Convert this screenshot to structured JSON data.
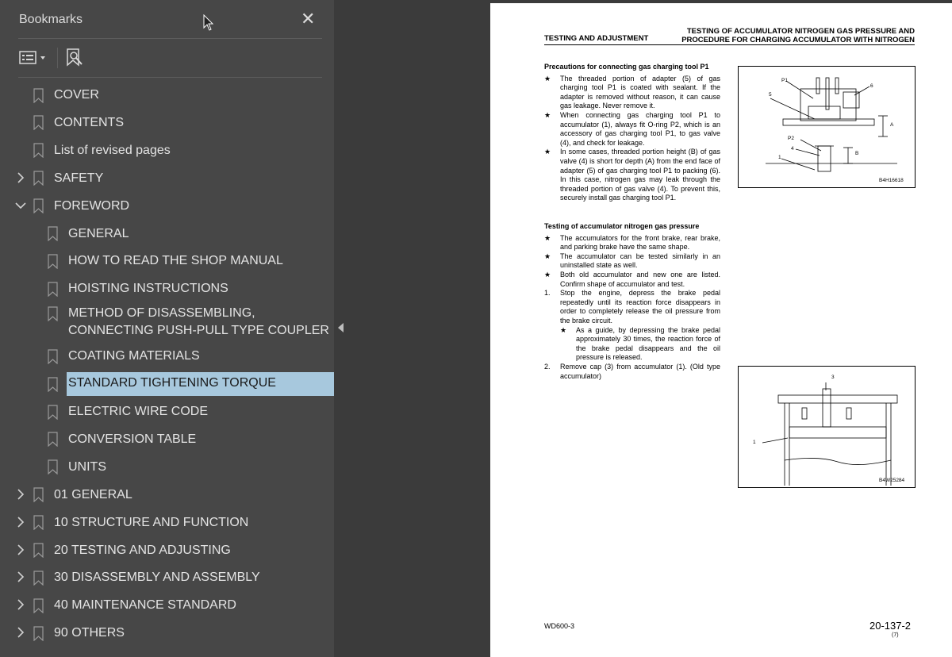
{
  "sidebar": {
    "title": "Bookmarks",
    "close_glyph": "✕",
    "toolbar": {
      "options_icon": "list-options-icon",
      "find_icon": "find-bookmark-icon"
    },
    "items": [
      {
        "label": "COVER",
        "level": 0,
        "expand": "none"
      },
      {
        "label": "CONTENTS",
        "level": 0,
        "expand": "none"
      },
      {
        "label": "List of revised pages",
        "level": 0,
        "expand": "none"
      },
      {
        "label": "SAFETY",
        "level": 0,
        "expand": "collapsed"
      },
      {
        "label": "FOREWORD",
        "level": 0,
        "expand": "expanded"
      },
      {
        "label": "GENERAL",
        "level": 1,
        "expand": "none"
      },
      {
        "label": "HOW TO READ THE SHOP MANUAL",
        "level": 1,
        "expand": "none"
      },
      {
        "label": "HOISTING INSTRUCTIONS",
        "level": 1,
        "expand": "none"
      },
      {
        "label": "METHOD OF DISASSEMBLING, CONNECTING PUSH-PULL TYPE COUPLER",
        "level": 1,
        "expand": "none"
      },
      {
        "label": "COATING MATERIALS",
        "level": 1,
        "expand": "none"
      },
      {
        "label": "STANDARD TIGHTENING TORQUE",
        "level": 1,
        "expand": "none",
        "selected": true
      },
      {
        "label": "ELECTRIC WIRE CODE",
        "level": 1,
        "expand": "none"
      },
      {
        "label": "CONVERSION TABLE",
        "level": 1,
        "expand": "none"
      },
      {
        "label": "UNITS",
        "level": 1,
        "expand": "none"
      },
      {
        "label": "01 GENERAL",
        "level": 0,
        "expand": "collapsed"
      },
      {
        "label": "10 STRUCTURE AND FUNCTION",
        "level": 0,
        "expand": "collapsed"
      },
      {
        "label": "20 TESTING AND ADJUSTING",
        "level": 0,
        "expand": "collapsed"
      },
      {
        "label": "30 DISASSEMBLY AND ASSEMBLY",
        "level": 0,
        "expand": "collapsed"
      },
      {
        "label": "40 MAINTENANCE STANDARD",
        "level": 0,
        "expand": "collapsed"
      },
      {
        "label": "90 OTHERS",
        "level": 0,
        "expand": "collapsed"
      }
    ]
  },
  "page": {
    "header_left": "TESTING AND ADJUSTMENT",
    "header_right_1": "TESTING OF ACCUMULATOR NITROGEN GAS PRESSURE AND",
    "header_right_2": "PROCEDURE FOR CHARGING ACCUMULATOR WITH NITROGEN",
    "section1": {
      "heading": "Precautions for connecting gas charging tool P1",
      "items": [
        {
          "mark": "★",
          "text": "The threaded portion of adapter (5) of gas charging tool P1 is coated with sealant. If the adapter is removed without reason, it can cause gas leakage. Never remove it."
        },
        {
          "mark": "★",
          "text": "When connecting gas charging tool P1 to accumulator (1), always fit O-ring P2, which is an accessory of gas charging tool P1, to gas valve (4), and check for leakage."
        },
        {
          "mark": "★",
          "text": "In some cases, threaded portion height (B) of gas valve (4) is short for depth (A) from the end face of adapter (5) of gas charging tool P1 to packing (6). In this case, nitrogen gas may leak through the threaded portion of gas valve (4). To prevent this, securely install gas charging tool P1."
        }
      ]
    },
    "section2": {
      "heading": "Testing of accumulator nitrogen gas pressure",
      "items": [
        {
          "mark": "★",
          "text": "The accumulators for the front brake, rear brake, and parking brake have the same shape."
        },
        {
          "mark": "★",
          "text": "The accumulator can be tested similarly in an uninstalled state as well."
        },
        {
          "mark": "★",
          "text": "Both old accumulator and new one are listed. Confirm shape of accumulator and test."
        },
        {
          "mark": "1.",
          "text": "Stop the engine, depress the brake pedal repeatedly until its reaction force disappears in order to completely release the oil pressure from the brake circuit."
        },
        {
          "mark": "★",
          "text": "As a guide, by depressing the brake pedal approximately 30 times, the reaction force of the brake pedal disappears and the oil pressure is released.",
          "sub": true
        },
        {
          "mark": "2.",
          "text": "Remove cap (3) from accumulator (1). (Old type accumulator)"
        }
      ]
    },
    "figure1": {
      "code": "B4H16618",
      "labels": [
        "P1",
        "6",
        "5",
        "P2",
        "4",
        "1",
        "A",
        "B"
      ]
    },
    "figure2": {
      "code": "B4W25284",
      "labels": [
        "3",
        "1"
      ]
    },
    "footer_left": "WD600-3",
    "footer_right": "20-137-2",
    "footer_rev": "(7)"
  }
}
